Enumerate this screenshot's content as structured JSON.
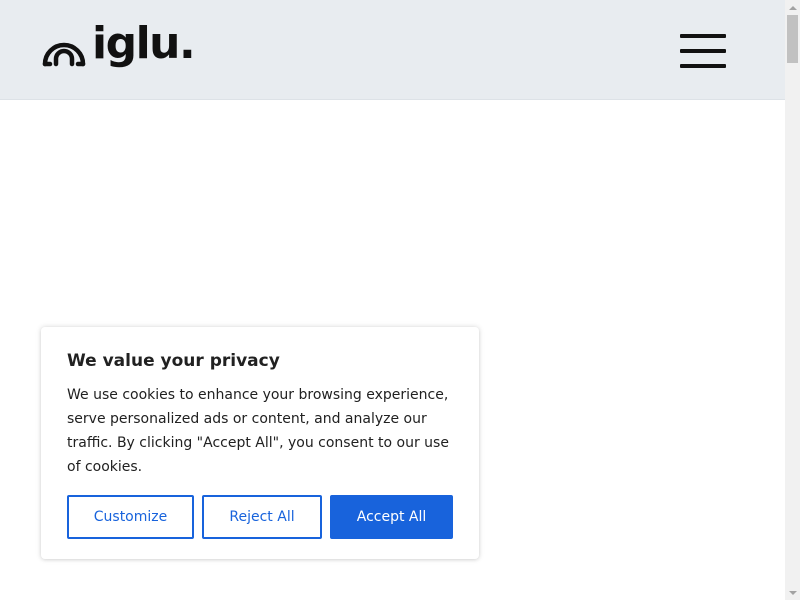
{
  "header": {
    "logo_text": "iglu."
  },
  "cookie_banner": {
    "title": "We value your privacy",
    "body": "We use cookies to enhance your browsing experience, serve personalized ads or content, and analyze our traffic. By clicking \"Accept All\", you consent to our use of cookies.",
    "buttons": {
      "customize": "Customize",
      "reject": "Reject All",
      "accept": "Accept All"
    }
  },
  "colors": {
    "header_bg": "#e8ecf0",
    "accent": "#1863dc",
    "text": "#212121"
  },
  "icons": {
    "logo": "iglu-dome-icon",
    "menu": "hamburger-menu-icon"
  }
}
